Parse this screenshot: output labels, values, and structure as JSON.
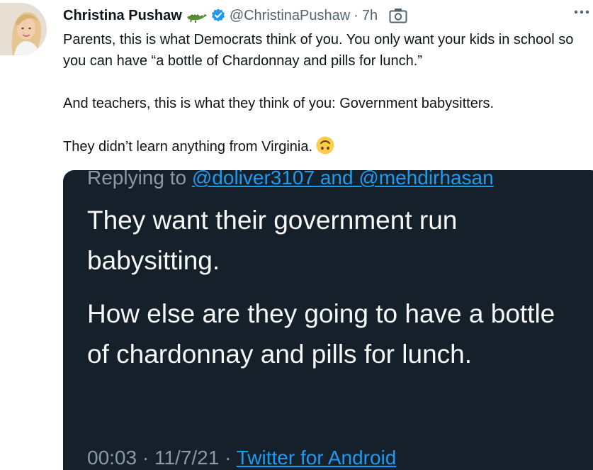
{
  "tweet": {
    "author_name": "Christina Pushaw",
    "handle": "@ChristinaPushaw",
    "separator": "·",
    "time": "7h",
    "paragraphs": [
      "Parents, this is what Democrats think of you. You only want your kids in school so you can have “a bottle of Chardonnay and pills for lunch.”",
      "And teachers, this is what they think of you: Government babysitters.",
      "They didn’t learn anything from Virginia."
    ],
    "icons": {
      "name_emoji": "crocodile-icon",
      "badge": "verified-badge-icon",
      "media_indicator": "camera-icon",
      "trailing_emoji": "upside-down-face-emoji-icon",
      "menu": "more-icon"
    },
    "colors": {
      "text": "#0f1419",
      "secondary": "#536471",
      "verified": "#1d9bf0",
      "media_bg": "#15202b"
    }
  },
  "media": {
    "replying_prefix": "Replying to",
    "mention_1": "@doliver3107",
    "conjunction": "and",
    "mention_2": "@mehdirhasan",
    "paragraphs": [
      "They want their government run babysitting.",
      "How else are they going to have a bottle of chardonnay and pills for lunch."
    ],
    "time": "00:03",
    "separator": "·",
    "date": "11/7/21",
    "source": "Twitter for Android"
  }
}
